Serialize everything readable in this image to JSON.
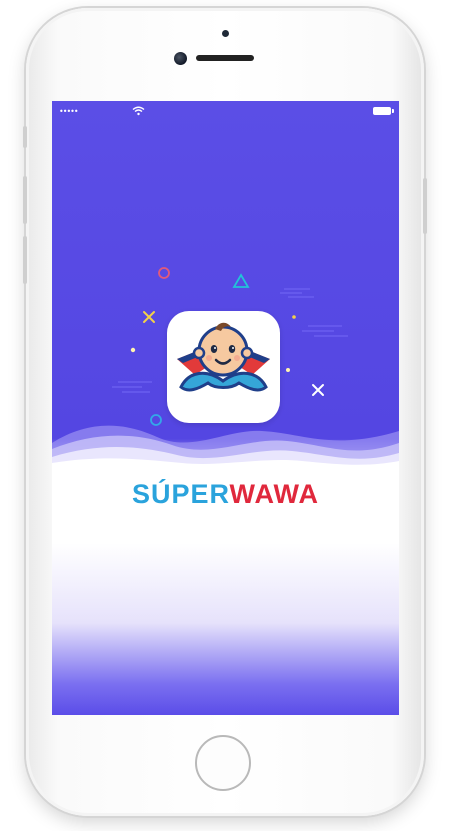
{
  "status_bar": {
    "signal": "•••••",
    "wifi_icon": "wifi-icon",
    "battery_icon": "battery-icon"
  },
  "splash": {
    "brand_part1": "SÚPER",
    "brand_part2": "WAWA",
    "app_icon": "baby-superhero-icon"
  },
  "colors": {
    "background_purple": "#5446e2",
    "brand_blue": "#2aa3dc",
    "brand_red": "#e0283c"
  }
}
